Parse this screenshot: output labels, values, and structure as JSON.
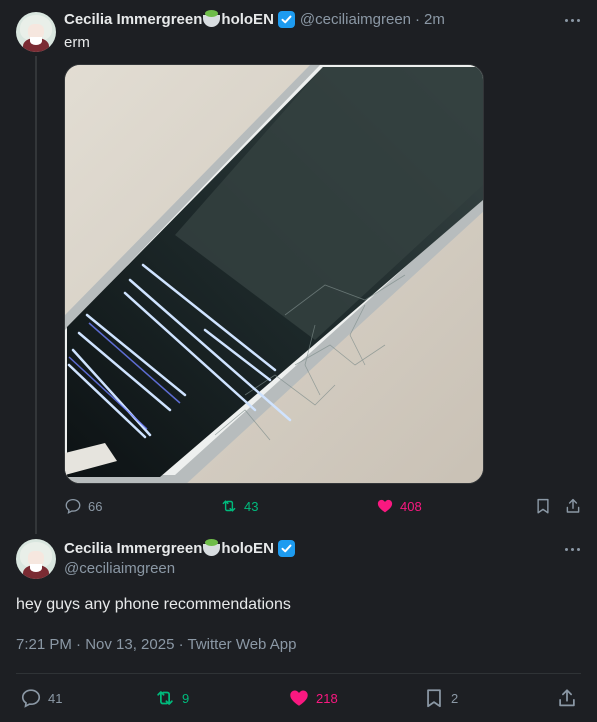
{
  "reply_tweet": {
    "display_name": "Cecilia Immergreen",
    "name_suffix": "holoEN",
    "handle": "@ceciliaimgreen",
    "separator": "·",
    "time": "2m",
    "text": "erm",
    "stats": {
      "replies": "66",
      "retweets": "43",
      "likes": "408"
    }
  },
  "main_tweet": {
    "display_name": "Cecilia Immergreen",
    "name_suffix": "holoEN",
    "handle": "@ceciliaimgreen",
    "text": "hey guys any phone recommendations",
    "timestamp": "7:21 PM · Nov 13, 2025 · Twitter Web App",
    "stats": {
      "replies": "41",
      "retweets": "9",
      "likes": "218",
      "bookmarks": "2"
    }
  },
  "colors": {
    "background": "#1d1f23",
    "text": "#e7e9ea",
    "muted": "#8b98a5",
    "retweet_green": "#00ba7c",
    "like_pink": "#f91880",
    "verified_blue": "#1d9bf0"
  },
  "icons": [
    "reply-icon",
    "retweet-icon",
    "like-icon",
    "bookmark-icon",
    "share-icon",
    "more-icon",
    "verified-icon",
    "salad-emoji-icon"
  ]
}
